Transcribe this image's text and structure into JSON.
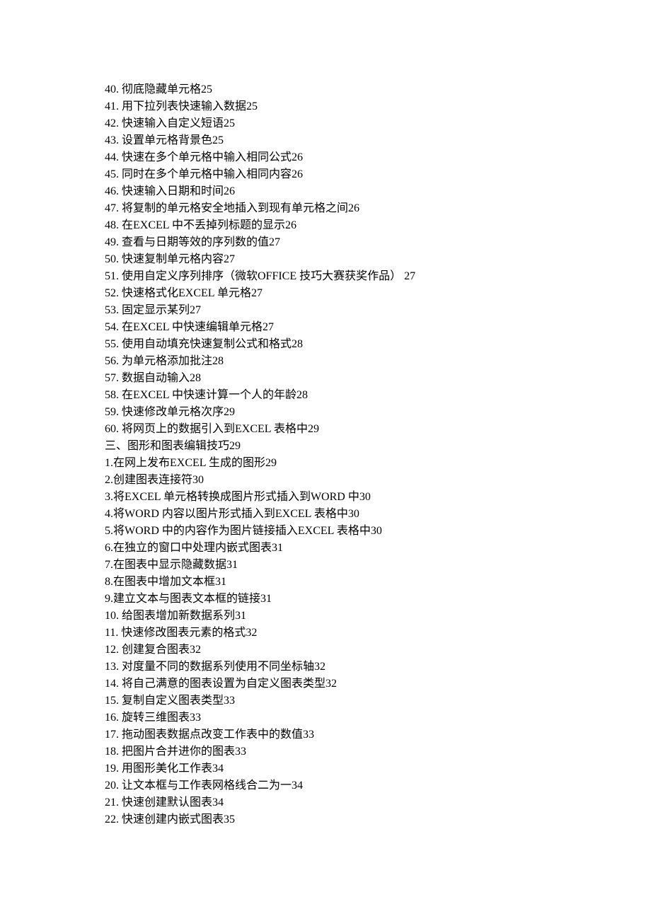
{
  "toc": [
    "40. 彻底隐藏单元格25",
    "41. 用下拉列表快速输入数据25",
    "42. 快速输入自定义短语25",
    "43. 设置单元格背景色25",
    "44. 快速在多个单元格中输入相同公式26",
    "45. 同时在多个单元格中输入相同内容26",
    "46. 快速输入日期和时间26",
    "47. 将复制的单元格安全地插入到现有单元格之间26",
    "48. 在EXCEL 中不丢掉列标题的显示26",
    "49. 查看与日期等效的序列数的值27",
    "50. 快速复制单元格内容27",
    "51. 使用自定义序列排序（微软OFFICE 技巧大赛获奖作品） 27",
    "52. 快速格式化EXCEL 单元格27",
    "53. 固定显示某列27",
    "54. 在EXCEL 中快速编辑单元格27",
    "55. 使用自动填充快速复制公式和格式28",
    "56. 为单元格添加批注28",
    "57. 数据自动输入28",
    "58. 在EXCEL 中快速计算一个人的年龄28",
    "59. 快速修改单元格次序29",
    "60. 将网页上的数据引入到EXCEL 表格中29",
    "三、图形和图表编辑技巧29",
    "1.在网上发布EXCEL 生成的图形29",
    "2.创建图表连接符30",
    "3.将EXCEL 单元格转换成图片形式插入到WORD 中30",
    "4.将WORD 内容以图片形式插入到EXCEL 表格中30",
    "5.将WORD 中的内容作为图片链接插入EXCEL 表格中30",
    "6.在独立的窗口中处理内嵌式图表31",
    "7.在图表中显示隐藏数据31",
    "8.在图表中增加文本框31",
    "9.建立文本与图表文本框的链接31",
    "10. 给图表增加新数据系列31",
    "11. 快速修改图表元素的格式32",
    "12. 创建复合图表32",
    "13. 对度量不同的数据系列使用不同坐标轴32",
    "14. 将自己满意的图表设置为自定义图表类型32",
    "15. 复制自定义图表类型33",
    "16. 旋转三维图表33",
    "17. 拖动图表数据点改变工作表中的数值33",
    "18. 把图片合并进你的图表33",
    "19. 用图形美化工作表34",
    "20. 让文本框与工作表网格线合二为一34",
    "21. 快速创建默认图表34",
    "22. 快速创建内嵌式图表35"
  ]
}
